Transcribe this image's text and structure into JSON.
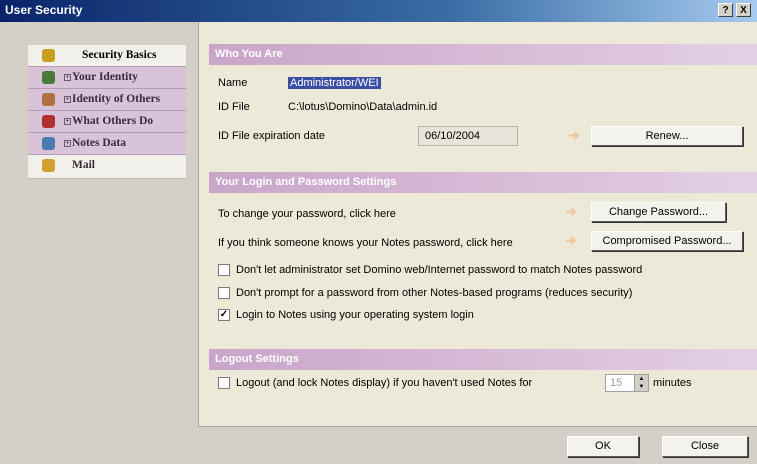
{
  "window": {
    "title": "User Security",
    "help_icon": "?",
    "close_icon": "X"
  },
  "sidebar": {
    "items": [
      {
        "label": "Security Basics",
        "icon": "key-icon",
        "color": "#c8a020"
      },
      {
        "label": "Your Identity",
        "icon": "badge-icon",
        "color": "#4a7a3a"
      },
      {
        "label": "Identity of Others",
        "icon": "people-icon",
        "color": "#b07040"
      },
      {
        "label": "What Others Do",
        "icon": "shield-icon",
        "color": "#b03030"
      },
      {
        "label": "Notes Data",
        "icon": "database-icon",
        "color": "#4a7ab0"
      },
      {
        "label": "Mail",
        "icon": "mail-icon",
        "color": "#d0a030"
      }
    ]
  },
  "who": {
    "header": "Who You Are",
    "name_label": "Name",
    "name_value": "Administrator/WEI",
    "idfile_label": "ID File",
    "idfile_value": "C:\\lotus\\Domino\\Data\\admin.id",
    "expiration_label": "ID File expiration date",
    "expiration_value": "06/10/2004",
    "renew_button": "Renew..."
  },
  "login": {
    "header": "Your Login and Password Settings",
    "change_text": "To change your password, click here",
    "change_button": "Change Password...",
    "compromised_text": "If you think someone knows your Notes password, click here",
    "compromised_button": "Compromised Password...",
    "checkboxes": [
      {
        "label": "Don't let administrator set Domino web/Internet password to match Notes password",
        "checked": false
      },
      {
        "label": "Don't prompt for a password from other Notes-based programs (reduces security)",
        "checked": false
      },
      {
        "label": "Login to Notes using your operating system login",
        "checked": true
      }
    ]
  },
  "logout": {
    "header": "Logout Settings",
    "checkbox_label": "Logout (and lock Notes display) if you haven't used Notes for",
    "minutes_value": "15",
    "minutes_label": "minutes"
  },
  "footer": {
    "ok_button": "OK",
    "close_button": "Close"
  }
}
